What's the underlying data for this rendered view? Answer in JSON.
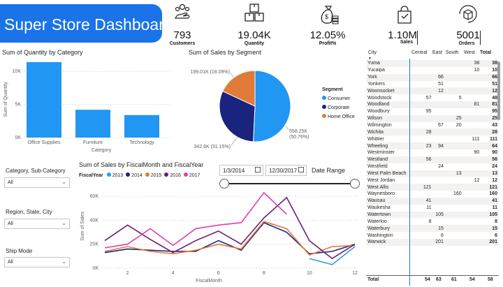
{
  "header": {
    "title": "Super Store Dashboard"
  },
  "kpis": [
    {
      "value": "793",
      "label": "Customers",
      "icon": "customers-icon"
    },
    {
      "value": "19.04K",
      "label": "Quantity",
      "icon": "boxes-icon"
    },
    {
      "value": "12.05%",
      "label": "Profit%",
      "icon": "money-bag-icon"
    },
    {
      "value": "1.10M",
      "label": "Sales",
      "icon": "shopping-bag-icon"
    },
    {
      "value": "5001",
      "label": "Orders",
      "icon": "order-box-icon"
    }
  ],
  "qty_chart": {
    "title": "Sum of Quantity by Category",
    "chart_data": {
      "type": "bar",
      "categories": [
        "Office Supplies",
        "Furniture",
        "Technology"
      ],
      "values": [
        11400,
        4200,
        3400
      ],
      "ylabel": "Sum of Quantity",
      "xlabel": "Category",
      "ylim": [
        0,
        11500
      ],
      "yticks": [
        "0K",
        "5K",
        "10K"
      ],
      "color": "#2196f3"
    }
  },
  "segment_chart": {
    "title": "Sum of Sales by Segment",
    "legend_title": "Segment",
    "chart_data": {
      "type": "pie",
      "slices": [
        {
          "name": "Consumer",
          "value": 558.25,
          "label": "558.25K (50.76%)",
          "color": "#2196f3"
        },
        {
          "name": "Corporate",
          "value": 342.6,
          "label": "342.6K (31.15%)",
          "color": "#1a237e"
        },
        {
          "name": "Home Office",
          "value": 199.01,
          "label": "199.01K (18.09%)",
          "color": "#e07b39"
        }
      ]
    }
  },
  "slicers": [
    {
      "label": "Category, Sub-Category",
      "value": "All"
    },
    {
      "label": "Region, State, City",
      "value": "All"
    },
    {
      "label": "Ship Mode",
      "value": "All"
    }
  ],
  "date_range": {
    "start": "1/3/2014",
    "end": "12/30/2017",
    "label": "Date Range"
  },
  "line_chart": {
    "title": "Sum of Sales by FiscalMonth and FiscalYear",
    "legend_title": "FiscalYear",
    "chart_data": {
      "type": "line",
      "x": [
        1,
        2,
        3,
        4,
        5,
        6,
        7,
        8,
        9,
        10,
        11,
        12
      ],
      "xticks": [
        "2",
        "4",
        "6",
        "8",
        "10",
        "12"
      ],
      "yticks": [
        "0K",
        "20K",
        "40K",
        "60K"
      ],
      "ylim": [
        0,
        70000
      ],
      "xlabel": "FiscalMonth",
      "ylabel": "Sum of Sales",
      "series": [
        {
          "name": "2013",
          "color": "#1fa1e6",
          "values": [
            null,
            null,
            null,
            null,
            null,
            null,
            null,
            null,
            null,
            8000,
            3000,
            18000
          ]
        },
        {
          "name": "2014",
          "color": "#1a237e",
          "values": [
            13000,
            16000,
            15000,
            14000,
            14000,
            23000,
            15000,
            38000,
            30000,
            12000,
            14000,
            20000
          ]
        },
        {
          "name": "2015",
          "color": "#e07b39",
          "values": [
            14000,
            18000,
            14000,
            12000,
            15000,
            20000,
            16000,
            39000,
            33000,
            11000,
            18000,
            19000
          ]
        },
        {
          "name": "2016",
          "color": "#6a1b7a",
          "values": [
            23000,
            36000,
            24000,
            13000,
            23000,
            31000,
            20000,
            42000,
            59000,
            23000,
            8000,
            20000
          ]
        },
        {
          "name": "2017",
          "color": "#e040b0",
          "values": [
            17000,
            20000,
            33000,
            19000,
            33000,
            36000,
            38000,
            63000,
            45000,
            null,
            null,
            null
          ]
        }
      ]
    }
  },
  "city_table": {
    "columns": [
      "City",
      "Central",
      "East",
      "South",
      "West",
      "Total"
    ],
    "rows": [
      [
        "Yuma",
        "",
        "",
        "",
        "38",
        "38"
      ],
      [
        "Yucaipa",
        "",
        "",
        "",
        "10",
        "10"
      ],
      [
        "York",
        "",
        "66",
        "",
        "",
        "66"
      ],
      [
        "Yonkers",
        "",
        "51",
        "",
        "",
        "51"
      ],
      [
        "Woonsocket",
        "",
        "12",
        "",
        "",
        "12"
      ],
      [
        "Woodstock",
        "57",
        "",
        "5",
        "",
        "48"
      ],
      [
        "Woodland",
        "",
        "",
        "",
        "81",
        "81"
      ],
      [
        "Woodbury",
        "95",
        "",
        "",
        "",
        "95"
      ],
      [
        "Wilson",
        "",
        "",
        "25",
        "",
        "25"
      ],
      [
        "Wilmington",
        "",
        "67",
        "20",
        "",
        "43"
      ],
      [
        "Wichita",
        "28",
        "",
        "",
        "",
        "28"
      ],
      [
        "Whittier",
        "",
        "",
        "",
        "111",
        "111"
      ],
      [
        "Wheeling",
        "23",
        "94",
        "",
        "",
        "64"
      ],
      [
        "Westminster",
        "",
        "",
        "",
        "90",
        "90"
      ],
      [
        "Westland",
        "56",
        "",
        "",
        "",
        "56"
      ],
      [
        "Westfield",
        "",
        "24",
        "",
        "",
        "24"
      ],
      [
        "West Palm Beach",
        "",
        "",
        "13",
        "",
        "13"
      ],
      [
        "West Jordan",
        "",
        "",
        "",
        "12",
        "12"
      ],
      [
        "West Allis",
        "121",
        "",
        "",
        "",
        "121"
      ],
      [
        "Waynesboro",
        "",
        "",
        "160",
        "",
        "160"
      ],
      [
        "Wausau",
        "41",
        "",
        "",
        "",
        "41"
      ],
      [
        "Waukesha",
        "11",
        "",
        "",
        "",
        "11"
      ],
      [
        "Watertown",
        "",
        "105",
        "",
        "",
        "105"
      ],
      [
        "Waterloo",
        "8",
        "",
        "",
        "",
        "8"
      ],
      [
        "Waterbury",
        "",
        "15",
        "",
        "",
        "15"
      ],
      [
        "Washington",
        "",
        "6",
        "",
        "",
        "6"
      ],
      [
        "Warwick",
        "",
        "201",
        "",
        "",
        "201"
      ]
    ],
    "total": [
      "Total",
      "54",
      "63",
      "61",
      "54",
      "58"
    ]
  }
}
